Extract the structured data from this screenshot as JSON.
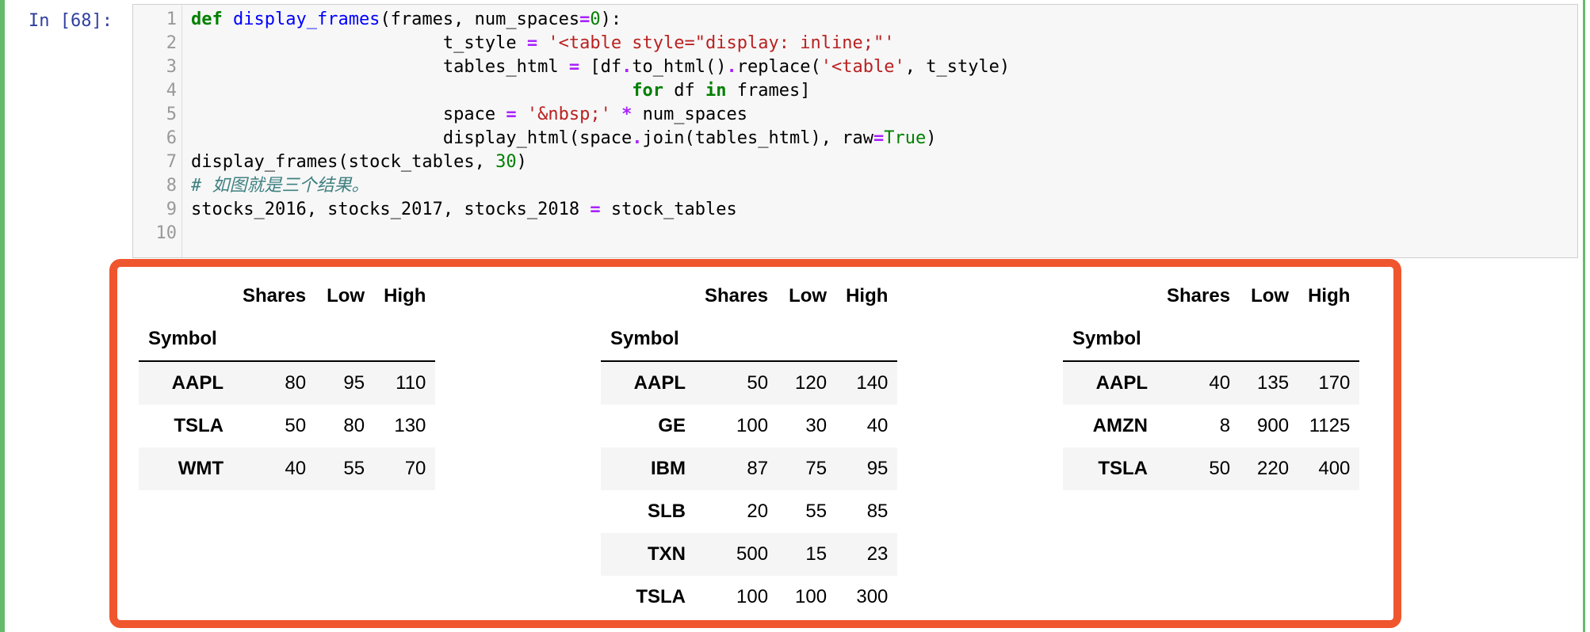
{
  "prompt": "In [68]:",
  "code": {
    "line_numbers": [
      "1",
      "2",
      "3",
      "4",
      "5",
      "6",
      "7",
      "8",
      "9",
      "10"
    ],
    "lines": [
      [
        {
          "t": "def",
          "c": "kw"
        },
        {
          "t": " "
        },
        {
          "t": "display_frames",
          "c": "fn"
        },
        {
          "t": "(frames, num_spaces"
        },
        {
          "t": "=",
          "c": "op"
        },
        {
          "t": "0",
          "c": "num"
        },
        {
          "t": "):"
        }
      ],
      [
        {
          "t": "                        t_style "
        },
        {
          "t": "=",
          "c": "op"
        },
        {
          "t": " "
        },
        {
          "t": "'<table style=\"display: inline;\"'",
          "c": "str"
        }
      ],
      [
        {
          "t": "                        tables_html "
        },
        {
          "t": "=",
          "c": "op"
        },
        {
          "t": " [df"
        },
        {
          "t": ".",
          "c": "op"
        },
        {
          "t": "to_html()"
        },
        {
          "t": ".",
          "c": "op"
        },
        {
          "t": "replace("
        },
        {
          "t": "'<table'",
          "c": "str"
        },
        {
          "t": ", t_style)"
        }
      ],
      [
        {
          "t": "                                          "
        },
        {
          "t": "for",
          "c": "kw"
        },
        {
          "t": " df "
        },
        {
          "t": "in",
          "c": "kw"
        },
        {
          "t": " frames]"
        }
      ],
      [
        {
          "t": "                        space "
        },
        {
          "t": "=",
          "c": "op"
        },
        {
          "t": " "
        },
        {
          "t": "'&nbsp;'",
          "c": "str"
        },
        {
          "t": " "
        },
        {
          "t": "*",
          "c": "op"
        },
        {
          "t": " num_spaces"
        }
      ],
      [
        {
          "t": "                        display_html(space"
        },
        {
          "t": ".",
          "c": "op"
        },
        {
          "t": "join(tables_html), raw"
        },
        {
          "t": "=",
          "c": "op"
        },
        {
          "t": "True",
          "c": "builtin"
        },
        {
          "t": ")"
        }
      ],
      [
        {
          "t": "display_frames(stock_tables, "
        },
        {
          "t": "30",
          "c": "num"
        },
        {
          "t": ")"
        }
      ],
      [
        {
          "t": "# 如图就是三个结果。",
          "c": "cm"
        }
      ],
      [
        {
          "t": "stocks_2016, stocks_2017, stocks_2018 "
        },
        {
          "t": "=",
          "c": "op"
        },
        {
          "t": " stock_tables"
        }
      ],
      []
    ]
  },
  "output_tables": [
    {
      "columns": [
        "Shares",
        "Low",
        "High"
      ],
      "index_name": "Symbol",
      "rows": [
        {
          "symbol": "AAPL",
          "values": [
            "80",
            "95",
            "110"
          ]
        },
        {
          "symbol": "TSLA",
          "values": [
            "50",
            "80",
            "130"
          ]
        },
        {
          "symbol": "WMT",
          "values": [
            "40",
            "55",
            "70"
          ]
        }
      ]
    },
    {
      "columns": [
        "Shares",
        "Low",
        "High"
      ],
      "index_name": "Symbol",
      "rows": [
        {
          "symbol": "AAPL",
          "values": [
            "50",
            "120",
            "140"
          ]
        },
        {
          "symbol": "GE",
          "values": [
            "100",
            "30",
            "40"
          ]
        },
        {
          "symbol": "IBM",
          "values": [
            "87",
            "75",
            "95"
          ]
        },
        {
          "symbol": "SLB",
          "values": [
            "20",
            "55",
            "85"
          ]
        },
        {
          "symbol": "TXN",
          "values": [
            "500",
            "15",
            "23"
          ]
        },
        {
          "symbol": "TSLA",
          "values": [
            "100",
            "100",
            "300"
          ]
        }
      ]
    },
    {
      "columns": [
        "Shares",
        "Low",
        "High"
      ],
      "index_name": "Symbol",
      "rows": [
        {
          "symbol": "AAPL",
          "values": [
            "40",
            "135",
            "170"
          ]
        },
        {
          "symbol": "AMZN",
          "values": [
            "8",
            "900",
            "1125"
          ]
        },
        {
          "symbol": "TSLA",
          "values": [
            "50",
            "220",
            "400"
          ]
        }
      ]
    }
  ],
  "colors": {
    "cell_selected_border": "#66bb6a",
    "highlight_frame": "#f0562e",
    "prompt": "#303f9f"
  }
}
